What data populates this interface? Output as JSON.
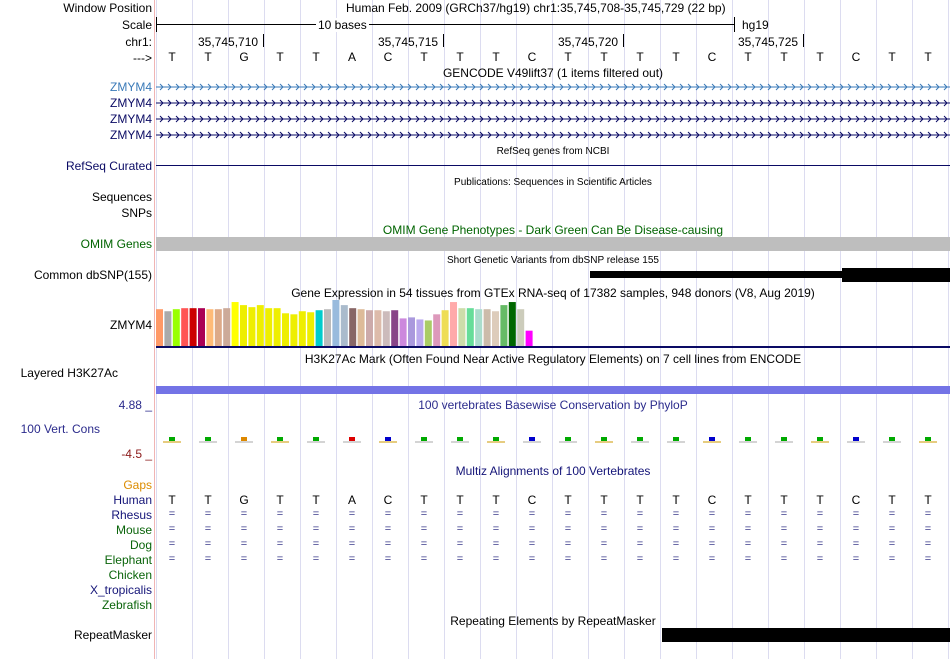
{
  "header": {
    "window_position_label": "Window Position",
    "scale_label": "Scale",
    "chrom_label": "chr1:",
    "strand_label": "--->",
    "assembly_title": "Human Feb. 2009 (GRCh37/hg19)   chr1:35,745,708-35,745,729 (22 bp)",
    "scale_text": "10 bases",
    "assembly_short": "hg19",
    "coords": [
      "35,745,710",
      "35,745,715",
      "35,745,720",
      "35,745,725"
    ]
  },
  "bases": [
    "T",
    "T",
    "G",
    "T",
    "T",
    "A",
    "C",
    "T",
    "T",
    "T",
    "C",
    "T",
    "T",
    "T",
    "T",
    "C",
    "T",
    "T",
    "T",
    "C",
    "T",
    "T"
  ],
  "tracks": {
    "gencode": {
      "title": "GENCODE V49lift37 (1 items filtered out)",
      "genes": [
        "ZMYM4",
        "ZMYM4",
        "ZMYM4",
        "ZMYM4"
      ]
    },
    "refseq": {
      "label": "RefSeq Curated",
      "title": "RefSeq genes from NCBI"
    },
    "publications": {
      "sequences_label": "Sequences",
      "snps_label": "SNPs",
      "title": "Publications: Sequences in Scientific Articles"
    },
    "omim": {
      "label": "OMIM Genes",
      "title": "OMIM Gene Phenotypes - Dark Green Can Be Disease-causing"
    },
    "dbsnp": {
      "label": "Common dbSNP(155)",
      "title": "Short Genetic Variants from dbSNP release 155"
    },
    "gtex": {
      "label": "ZMYM4",
      "title": "Gene Expression in 54 tissues from GTEx RNA-seq of 17382 samples, 948 donors (V8, Aug 2019)"
    },
    "h3k27ac": {
      "label": "Layered H3K27Ac",
      "title": "H3K27Ac Mark (Often Found Near Active Regulatory Elements) on 7 cell lines from ENCODE"
    },
    "phylop": {
      "label": "100 Vert. Cons",
      "max": "4.88 _",
      "min": "-4.5 _",
      "title": "100 vertebrates Basewise Conservation by PhyloP"
    },
    "multiz": {
      "title": "Multiz Alignments of 100 Vertebrates",
      "gaps_label": "Gaps",
      "species": [
        "Human",
        "Rhesus",
        "Mouse",
        "Dog",
        "Elephant",
        "Chicken",
        "X_tropicalis",
        "Zebrafish"
      ],
      "equals": "="
    },
    "repeatmasker": {
      "label": "RepeatMasker",
      "title": "Repeating Elements by RepeatMasker"
    }
  },
  "colors": {
    "gencode_first": "#3a7ab8",
    "navy": "#0a0a64",
    "omim_green": "#006400",
    "omim_bar": "#bebebe",
    "h3k27ac_bar": "#7373e6",
    "phylop_label": "#2b2b8c",
    "gaps_orange": "#dc8c00",
    "species_navy": "#141478",
    "species_green": "#0a640a"
  },
  "gtex_colors": [
    "#ff9966",
    "#aaaaaa",
    "#99ff00",
    "#ff5555",
    "#cc0000",
    "#aa0055",
    "#ffbb77",
    "#ddaa88",
    "#ccaa99",
    "#ffff00",
    "#eeee00",
    "#eeee00",
    "#eeee00",
    "#eeee00",
    "#eeee00",
    "#eeee00",
    "#eeee00",
    "#eeee00",
    "#eeee00",
    "#00cccc",
    "#bbbbbb",
    "#99bbdd",
    "#aabbcc",
    "#886666",
    "#ddbb99",
    "#ccaaaa",
    "#ddbbaa",
    "#ccbbbb",
    "#884488",
    "#cc88dd",
    "#aa99dd",
    "#bbaaee",
    "#aacc66",
    "#dd99bb",
    "#eedd55",
    "#ffaaaa",
    "#ccddaa",
    "#66dd99",
    "#aaddcc",
    "#ccbbaa",
    "#ddccbb",
    "#66bb66",
    "#006600",
    "#ccccbb",
    "#ff00ff"
  ],
  "gtex_values": [
    36,
    34,
    36,
    37,
    37,
    37,
    36,
    36,
    37,
    43,
    40,
    38,
    40,
    37,
    37,
    32,
    31,
    34,
    33,
    35,
    36,
    45,
    40,
    37,
    36,
    35,
    35,
    34,
    35,
    27,
    28,
    26,
    25,
    31,
    35,
    43,
    37,
    37,
    36,
    36,
    34,
    40,
    43,
    36,
    15
  ]
}
